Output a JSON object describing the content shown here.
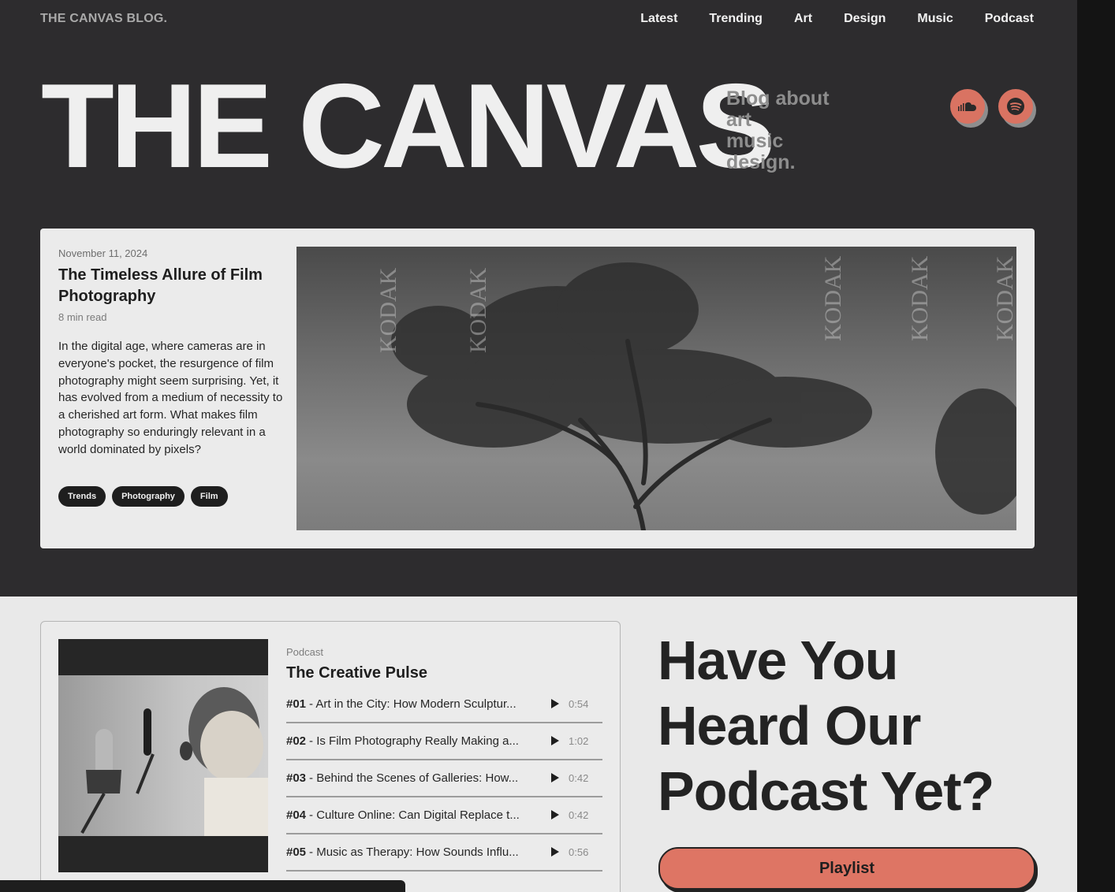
{
  "header": {
    "brand": "THE CANVAS BLOG.",
    "nav": [
      "Latest",
      "Trending",
      "Art",
      "Design",
      "Music",
      "Podcast"
    ]
  },
  "hero": {
    "title": "THE CANVAS",
    "tagline": [
      "Blog about",
      "art",
      "music",
      "design."
    ],
    "social_icons": [
      "soundcloud-icon",
      "spotify-icon"
    ]
  },
  "featured": {
    "date": "November 11, 2024",
    "title": "The Timeless Allure of Film Photography",
    "read_time": "8 min read",
    "excerpt": "In the digital age, where cameras are in everyone's pocket, the resurgence of film photography might seem surprising. Yet, it has evolved from a medium of necessity to a cherished art form. What makes film photography so enduringly relevant in a world dominated by pixels?",
    "tags": [
      "Trends",
      "Photography",
      "Film"
    ],
    "image_watermark": "KODAK"
  },
  "podcast": {
    "label": "Podcast",
    "title": "The Creative Pulse",
    "episodes": [
      {
        "num": "#01",
        "title": " - Art in the City: How Modern Sculptur...",
        "duration": "0:54"
      },
      {
        "num": "#02",
        "title": " - Is Film Photography Really Making a...",
        "duration": "1:02"
      },
      {
        "num": "#03",
        "title": " - Behind the Scenes of Galleries: How...",
        "duration": "0:42"
      },
      {
        "num": "#04",
        "title": " - Culture Online: Can Digital Replace t...",
        "duration": "0:42"
      },
      {
        "num": "#05",
        "title": " - Music as Therapy: How Sounds Influ...",
        "duration": "0:56"
      }
    ],
    "heading_lines": [
      "Have You",
      "Heard Our",
      "Podcast Yet?"
    ],
    "playlist_label": "Playlist"
  },
  "colors": {
    "dark_bg": "#2d2c2e",
    "light_bg": "#e9e9e9",
    "accent": "#d97362"
  }
}
